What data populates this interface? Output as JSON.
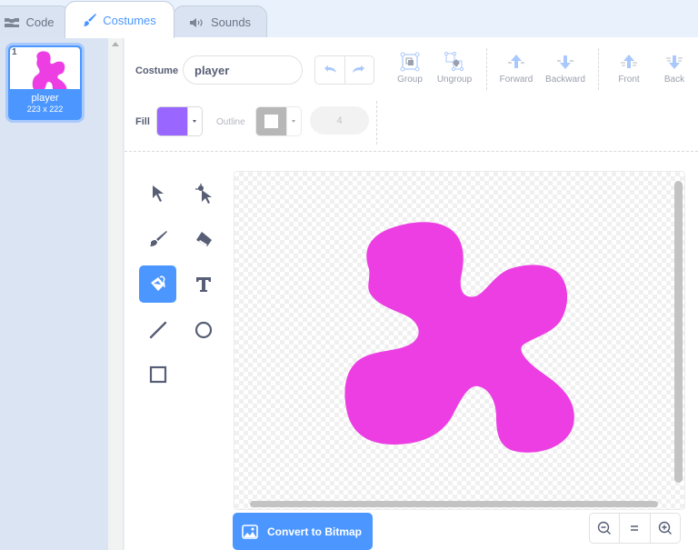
{
  "tabs": [
    {
      "label": "Code",
      "icon": "code-blocks-icon"
    },
    {
      "label": "Costumes",
      "icon": "paintbrush-icon",
      "active": true
    },
    {
      "label": "Sounds",
      "icon": "speaker-icon"
    }
  ],
  "costumes": [
    {
      "number": "1",
      "name": "player",
      "size": "223 x 222",
      "selected": true
    }
  ],
  "editor": {
    "costume_label": "Costume",
    "costume_name": "player",
    "undo_label": "Undo",
    "redo_label": "Redo",
    "toolbar": {
      "group": "Group",
      "ungroup": "Ungroup",
      "forward": "Forward",
      "backward": "Backward",
      "front": "Front",
      "back": "Back"
    },
    "fill_label": "Fill",
    "fill_color": "#9966ff",
    "outline_label": "Outline",
    "outline_color": "#ffffff",
    "stroke_width": "4",
    "tools": [
      {
        "name": "select",
        "active": false
      },
      {
        "name": "reshape",
        "active": false
      },
      {
        "name": "brush",
        "active": false
      },
      {
        "name": "eraser",
        "active": false
      },
      {
        "name": "fill",
        "active": true
      },
      {
        "name": "text",
        "active": false
      },
      {
        "name": "line",
        "active": false
      },
      {
        "name": "circle",
        "active": false
      },
      {
        "name": "rectangle",
        "active": false
      }
    ],
    "shape_color": "#ec3ee3",
    "convert_label": "Convert to Bitmap",
    "zoom": {
      "out": "Zoom out",
      "reset": "Reset zoom",
      "in": "Zoom in"
    }
  },
  "colors": {
    "accent": "#4c97ff",
    "text": "#575e75",
    "shape": "#ec3ee3",
    "fill_swatch": "#9966ff"
  }
}
